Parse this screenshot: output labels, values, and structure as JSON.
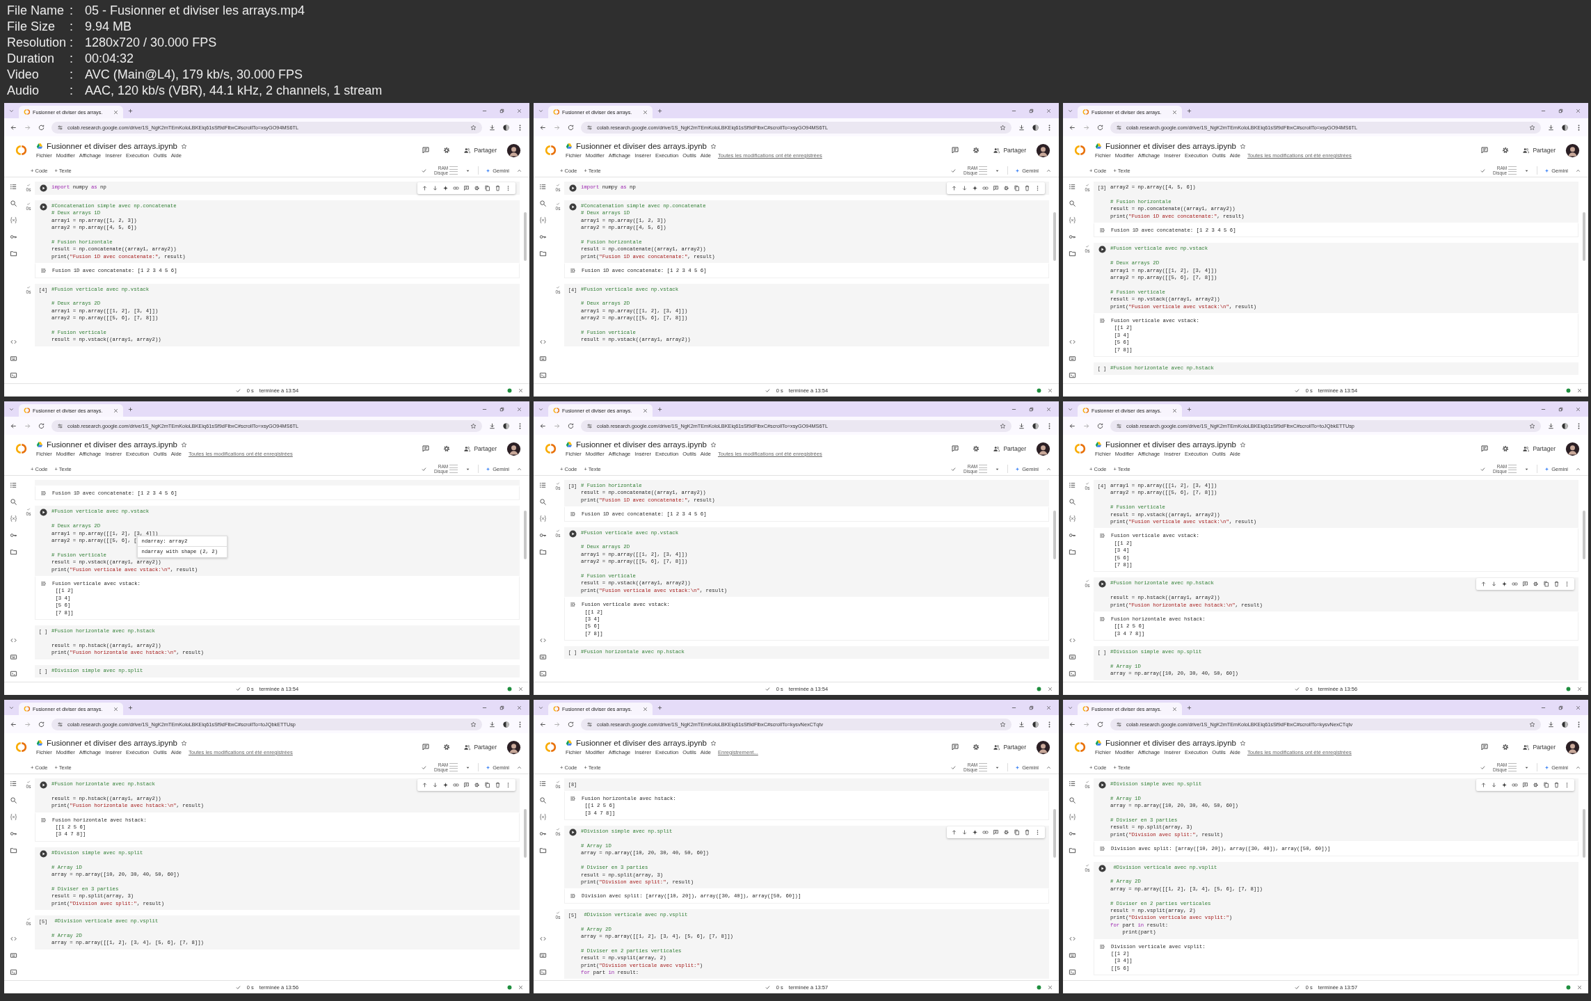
{
  "info": [
    {
      "label": "File Name",
      "separator": ":",
      "value": "05 - Fusionner et diviser les arrays.mp4"
    },
    {
      "label": "File Size",
      "separator": ":",
      "value": "9.94 MB"
    },
    {
      "label": "Resolution",
      "separator": ":",
      "value": "1280x720 / 30.000 FPS"
    },
    {
      "label": "Duration",
      "separator": ":",
      "value": "00:04:32"
    },
    {
      "label": "Video",
      "separator": ":",
      "value": "AVC (Main@L4), 179 kb/s, 30.000 FPS"
    },
    {
      "label": "Audio",
      "separator": ":",
      "value": "AAC, 120 kb/s (VBR), 44.1 kHz, 2 channels, 1 stream"
    }
  ],
  "frames": [
    {
      "tab_title": "Fusionner et diviser des arrays.",
      "url": "colab.research.google.com/drive/1S_NgK2mTEmKoloLBKEiq61sSf9dFlbxC#scrollTo=xsyGO94MS6TL",
      "notebook_title": "Fusionner et diviser des arrays.ipynb",
      "menu": [
        "Fichier",
        "Modifier",
        "Affichage",
        "Insérer",
        "Exécution",
        "Outils",
        "Aide"
      ],
      "add_code": "+ Code",
      "add_text": "+ Texte",
      "ram": "RAM",
      "disk": "Disque",
      "gemini": "Gemini",
      "share": "Partager",
      "run_time": "0 s",
      "finished": "terminée à 13:54",
      "cells": [
        {
          "time": "0s",
          "kind": "run",
          "toolbar": true,
          "blocks": [
            [
              {
                "kind": "mixed",
                "parts": [
                  {
                    "kind": "keyword",
                    "text": "import"
                  },
                  {
                    "kind": "plain",
                    "text": " numpy "
                  },
                  {
                    "kind": "keyword",
                    "text": "as"
                  },
                  {
                    "kind": "plain",
                    "text": " np"
                  }
                ]
              }
            ]
          ]
        },
        {
          "time": "0s",
          "kind": "run",
          "toolbar": false,
          "blocks": [
            [
              {
                "kind": "comment",
                "text": "#Concatenation simple avec np.concatenate"
              },
              {
                "kind": "comment",
                "text": "# Deux arrays 1D"
              },
              {
                "kind": "code",
                "text": "array1 = np.array([1, 2, 3])"
              },
              {
                "kind": "code",
                "text": "array2 = np.array([4, 5, 6])"
              }
            ],
            [
              {
                "kind": "comment",
                "text": "# Fusion horizontale"
              },
              {
                "kind": "code",
                "text": "result = np.concatenate((array1, array2))"
              },
              {
                "kind": "mixed",
                "parts": [
                  {
                    "kind": "plain",
                    "text": "print("
                  },
                  {
                    "kind": "string",
                    "text": "\"Fusion 1D avec concatenate:\""
                  },
                  {
                    "kind": "plain",
                    "text": ", result)"
                  }
                ]
              }
            ]
          ],
          "output": [
            "Fusion 1D avec concatenate: [1 2 3 4 5 6]"
          ]
        },
        {
          "time": "0s",
          "kind": "count",
          "count": "[4]",
          "toolbar": false,
          "blocks": [
            [
              {
                "kind": "comment",
                "text": "#Fusion verticale avec np.vstack"
              }
            ],
            [
              {
                "kind": "comment",
                "text": "# Deux arrays 2D"
              },
              {
                "kind": "code",
                "text": "array1 = np.array([[1, 2], [3, 4]])"
              },
              {
                "kind": "code",
                "text": "array2 = np.array([[5, 6], [7, 8]])"
              }
            ],
            [
              {
                "kind": "comment",
                "text": "# Fusion verticale"
              },
              {
                "kind": "code",
                "text": "result = np.vstack((array1, array2))"
              }
            ]
          ]
        }
      ]
    },
    {
      "tab_title": "Fusionner et diviser des arrays.",
      "url": "colab.research.google.com/drive/1S_NgK2mTEmKoloLBKEiq61sSf9dFlbxC#scrollTo=xsyGO94MS6TL",
      "notebook_title": "Fusionner et diviser des arrays.ipynb",
      "menu": [
        "Fichier",
        "Modifier",
        "Affichage",
        "Insérer",
        "Exécution",
        "Outils",
        "Aide"
      ],
      "save_status": "Toutes les modifications ont été enregistrées",
      "add_code": "+ Code",
      "add_text": "+ Texte",
      "ram": "RAM",
      "disk": "Disque",
      "gemini": "Gemini",
      "share": "Partager",
      "run_time": "0 s",
      "finished": "terminée à 13:54",
      "cells": [
        {
          "time": "0s",
          "kind": "run",
          "toolbar": true,
          "blocks": [
            [
              {
                "kind": "mixed",
                "parts": [
                  {
                    "kind": "keyword",
                    "text": "import"
                  },
                  {
                    "kind": "plain",
                    "text": " numpy "
                  },
                  {
                    "kind": "keyword",
                    "text": "as"
                  },
                  {
                    "kind": "plain",
                    "text": " np"
                  }
                ]
              }
            ]
          ]
        },
        {
          "time": "0s",
          "kind": "run",
          "toolbar": false,
          "blocks": [
            [
              {
                "kind": "comment",
                "text": "#Concatenation simple avec np.concatenate"
              },
              {
                "kind": "comment",
                "text": "# Deux arrays 1D"
              },
              {
                "kind": "code",
                "text": "array1 = np.array([1, 2, 3])"
              },
              {
                "kind": "code",
                "text": "array2 = np.array([4, 5, 6])"
              }
            ],
            [
              {
                "kind": "comment",
                "text": "# Fusion horizontale"
              },
              {
                "kind": "code",
                "text": "result = np.concatenate((array1, array2))"
              },
              {
                "kind": "mixed",
                "parts": [
                  {
                    "kind": "plain",
                    "text": "print("
                  },
                  {
                    "kind": "string",
                    "text": "\"Fusion 1D avec concatenate:\""
                  },
                  {
                    "kind": "plain",
                    "text": ", result)"
                  }
                ]
              }
            ]
          ],
          "output": [
            "Fusion 1D avec concatenate: [1 2 3 4 5 6]"
          ]
        },
        {
          "time": "0s",
          "kind": "count",
          "count": "[4]",
          "toolbar": false,
          "blocks": [
            [
              {
                "kind": "comment",
                "text": "#Fusion verticale avec np.vstack"
              }
            ],
            [
              {
                "kind": "comment",
                "text": "# Deux arrays 2D"
              },
              {
                "kind": "code",
                "text": "array1 = np.array([[1, 2], [3, 4]])"
              },
              {
                "kind": "code",
                "text": "array2 = np.array([[5, 6], [7, 8]])"
              }
            ],
            [
              {
                "kind": "comment",
                "text": "# Fusion verticale"
              },
              {
                "kind": "code",
                "text": "result = np.vstack((array1, array2))"
              }
            ]
          ]
        }
      ]
    },
    {
      "tab_title": "Fusionner et diviser des arrays.",
      "url": "colab.research.google.com/drive/1S_NgK2mTEmKoloLBKEiq61sSf9dFlbxC#scrollTo=xsyGO94MS6TL",
      "notebook_title": "Fusionner et diviser des arrays.ipynb",
      "menu": [
        "Fichier",
        "Modifier",
        "Affichage",
        "Insérer",
        "Exécution",
        "Outils",
        "Aide"
      ],
      "save_status": "Toutes les modifications ont été enregistrées",
      "add_code": "+ Code",
      "add_text": "+ Texte",
      "ram": "RAM",
      "disk": "Disque",
      "gemini": "Gemini",
      "share": "Partager",
      "run_time": "0 s",
      "finished": "terminée à 13:54",
      "cells": [
        {
          "time": "0s",
          "kind": "count",
          "count": "[3]",
          "toolbar": false,
          "blocks": [
            [
              {
                "kind": "code",
                "text": "array2 = np.array([4, 5, 6])"
              }
            ],
            [
              {
                "kind": "comment",
                "text": "# Fusion horizontale"
              },
              {
                "kind": "code",
                "text": "result = np.concatenate((array1, array2))"
              },
              {
                "kind": "mixed",
                "parts": [
                  {
                    "kind": "plain",
                    "text": "print("
                  },
                  {
                    "kind": "string",
                    "text": "\"Fusion 1D avec concatenate:\""
                  },
                  {
                    "kind": "plain",
                    "text": ", result)"
                  }
                ]
              }
            ]
          ],
          "output": [
            "Fusion 1D avec concatenate: [1 2 3 4 5 6]"
          ]
        },
        {
          "time": "0s",
          "kind": "run",
          "toolbar": false,
          "blocks": [
            [
              {
                "kind": "comment",
                "text": "#Fusion verticale avec np.vstack"
              }
            ],
            [
              {
                "kind": "comment",
                "text": "# Deux arrays 2D"
              },
              {
                "kind": "code",
                "text": "array1 = np.array([[1, 2], [3, 4]])"
              },
              {
                "kind": "code",
                "text": "array2 = np.array([[5, 6], [7, 8]])"
              }
            ],
            [
              {
                "kind": "comment",
                "text": "# Fusion verticale"
              },
              {
                "kind": "code",
                "text": "result = np.vstack((array1, array2))"
              },
              {
                "kind": "mixed",
                "parts": [
                  {
                    "kind": "plain",
                    "text": "print("
                  },
                  {
                    "kind": "string",
                    "text": "\"Fusion verticale avec vstack:\\n\""
                  },
                  {
                    "kind": "plain",
                    "text": ", result)"
                  }
                ]
              }
            ]
          ],
          "output": [
            "Fusion verticale avec vstack:",
            " [[1 2]",
            " [3 4]",
            " [5 6]",
            " [7 8]]"
          ]
        },
        {
          "kind": "count",
          "count": "[ ]",
          "toolbar": false,
          "blocks": [
            [
              {
                "kind": "comment",
                "text": "#Fusion horizontale avec np.hstack"
              }
            ]
          ]
        }
      ]
    },
    {
      "tab_title": "Fusionner et diviser des arrays.",
      "url": "colab.research.google.com/drive/1S_NgK2mTEmKoloLBKEiq61sSf9dFlbxC#scrollTo=xsyGO94MS6TL",
      "notebook_title": "Fusionner et diviser des arrays.ipynb",
      "menu": [
        "Fichier",
        "Modifier",
        "Affichage",
        "Insérer",
        "Exécution",
        "Outils",
        "Aide"
      ],
      "save_status": "Toutes les modifications ont été enregistrées",
      "add_code": "+ Code",
      "add_text": "+ Texte",
      "ram": "RAM",
      "disk": "Disque",
      "gemini": "Gemini",
      "share": "Partager",
      "run_time": "0 s",
      "finished": "terminée à 13:54",
      "cells": [
        {
          "kind": "output",
          "toolbar": false,
          "output": [
            "Fusion 1D avec concatenate: [1 2 3 4 5 6]"
          ]
        },
        {
          "time": "0s",
          "kind": "run",
          "toolbar": false,
          "blocks": [
            [
              {
                "kind": "comment",
                "text": "#Fusion verticale avec np.vstack"
              }
            ],
            [
              {
                "kind": "comment",
                "text": "# Deux arrays 2D"
              },
              {
                "kind": "code",
                "text": "array1 = np.array([[1, 2], [3, 4]])"
              },
              {
                "kind": "code",
                "text": "array2 = np.array([[5, 6], [",
                "tooltip": [
                  "ndarray: array2",
                  "ndarray with shape (2, 2)"
                ]
              }
            ],
            [
              {
                "kind": "comment",
                "text": "# Fusion verticale"
              },
              {
                "kind": "code",
                "text": "result = np.vstack((array1, array2))"
              },
              {
                "kind": "mixed",
                "parts": [
                  {
                    "kind": "plain",
                    "text": "print("
                  },
                  {
                    "kind": "string",
                    "text": "\"Fusion verticale avec vstack:\\n\""
                  },
                  {
                    "kind": "plain",
                    "text": ", result)"
                  }
                ]
              }
            ]
          ],
          "output": [
            "Fusion verticale avec vstack:",
            " [[1 2]",
            " [3 4]",
            " [5 6]",
            " [7 8]]"
          ]
        },
        {
          "kind": "count",
          "count": "[ ]",
          "toolbar": false,
          "blocks": [
            [
              {
                "kind": "comment",
                "text": "#Fusion horizontale avec np.hstack"
              }
            ],
            [
              {
                "kind": "code",
                "text": "result = np.hstack((array1, array2))"
              },
              {
                "kind": "mixed",
                "parts": [
                  {
                    "kind": "plain",
                    "text": "print("
                  },
                  {
                    "kind": "string",
                    "text": "\"Fusion horizontale avec hstack:\\n\""
                  },
                  {
                    "kind": "plain",
                    "text": ", result)"
                  }
                ]
              }
            ]
          ]
        },
        {
          "kind": "count",
          "count": "[ ]",
          "toolbar": false,
          "blocks": [
            [
              {
                "kind": "comment",
                "text": "#Division simple avec np.split"
              }
            ]
          ]
        }
      ]
    },
    {
      "tab_title": "Fusionner et diviser des arrays.",
      "url": "colab.research.google.com/drive/1S_NgK2mTEmKoloLBKEiq61sSf9dFlbxC#scrollTo=xsyGO94MS6TL",
      "notebook_title": "Fusionner et diviser des arrays.ipynb",
      "menu": [
        "Fichier",
        "Modifier",
        "Affichage",
        "Insérer",
        "Exécution",
        "Outils",
        "Aide"
      ],
      "save_status": "Toutes les modifications ont été enregistrées",
      "add_code": "+ Code",
      "add_text": "+ Texte",
      "ram": "RAM",
      "disk": "Disque",
      "gemini": "Gemini",
      "share": "Partager",
      "run_time": "0 s",
      "finished": "terminée à 13:54",
      "cells": [
        {
          "time": "0s",
          "kind": "count",
          "count": "[3]",
          "toolbar": false,
          "blocks": [
            [
              {
                "kind": "comment",
                "text": "# Fusion horizontale"
              },
              {
                "kind": "code",
                "text": "result = np.concatenate((array1, array2))"
              },
              {
                "kind": "mixed",
                "parts": [
                  {
                    "kind": "plain",
                    "text": "print("
                  },
                  {
                    "kind": "string",
                    "text": "\"Fusion 1D avec concatenate:\""
                  },
                  {
                    "kind": "plain",
                    "text": ", result)"
                  }
                ]
              }
            ]
          ],
          "output": [
            "Fusion 1D avec concatenate: [1 2 3 4 5 6]"
          ]
        },
        {
          "time": "0s",
          "kind": "run",
          "toolbar": false,
          "blocks": [
            [
              {
                "kind": "comment",
                "text": "#Fusion verticale avec np.vstack"
              }
            ],
            [
              {
                "kind": "comment",
                "text": "# Deux arrays 2D"
              },
              {
                "kind": "code",
                "text": "array1 = np.array([[1, 2], [3, 4]])"
              },
              {
                "kind": "code",
                "text": "array2 = np.array([[5, 6], [7, 8]])"
              }
            ],
            [
              {
                "kind": "comment",
                "text": "# Fusion verticale"
              },
              {
                "kind": "code",
                "text": "result = np.vstack((array1, array2))"
              },
              {
                "kind": "mixed",
                "parts": [
                  {
                    "kind": "plain",
                    "text": "print("
                  },
                  {
                    "kind": "string",
                    "text": "\"Fusion verticale avec vstack:\\n\""
                  },
                  {
                    "kind": "plain",
                    "text": ", result)"
                  }
                ]
              }
            ]
          ],
          "output": [
            "Fusion verticale avec vstack:",
            " [[1 2]",
            " [3 4]",
            " [5 6]",
            " [7 8]]"
          ]
        },
        {
          "kind": "count",
          "count": "[ ]",
          "toolbar": false,
          "blocks": [
            [
              {
                "kind": "comment",
                "text": "#Fusion horizontale avec np.hstack"
              }
            ]
          ]
        }
      ]
    },
    {
      "tab_title": "Fusionner et diviser des arrays.",
      "url": "colab.research.google.com/drive/1S_NgK2mTEmKoloLBKEiq61sSf9dFlbxC#scrollTo=toJQbkETTUsp",
      "notebook_title": "Fusionner et diviser des arrays.ipynb",
      "menu": [
        "Fichier",
        "Modifier",
        "Affichage",
        "Insérer",
        "Exécution",
        "Outils",
        "Aide"
      ],
      "add_code": "+ Code",
      "add_text": "+ Texte",
      "ram": "RAM",
      "disk": "Disque",
      "gemini": "Gemini",
      "share": "Partager",
      "run_time": "0 s",
      "finished": "terminée à 13:56",
      "cells": [
        {
          "time": "0s",
          "kind": "count",
          "count": "[4]",
          "toolbar": false,
          "blocks": [
            [
              {
                "kind": "code",
                "text": "array1 = np.array([[1, 2], [3, 4]])"
              },
              {
                "kind": "code",
                "text": "array2 = np.array([[5, 6], [7, 8]])"
              }
            ],
            [
              {
                "kind": "comment",
                "text": "# Fusion verticale"
              },
              {
                "kind": "code",
                "text": "result = np.vstack((array1, array2))"
              },
              {
                "kind": "mixed",
                "parts": [
                  {
                    "kind": "plain",
                    "text": "print("
                  },
                  {
                    "kind": "string",
                    "text": "\"Fusion verticale avec vstack:\\n\""
                  },
                  {
                    "kind": "plain",
                    "text": ", result)"
                  }
                ]
              }
            ]
          ],
          "output": [
            "Fusion verticale avec vstack:",
            " [[1 2]",
            " [3 4]",
            " [5 6]",
            " [7 8]]"
          ]
        },
        {
          "time": "0s",
          "kind": "run",
          "toolbar": true,
          "blocks": [
            [
              {
                "kind": "comment",
                "text": "#Fusion horizontale avec np.hstack"
              }
            ],
            [
              {
                "kind": "code",
                "text": "result = np.hstack((array1, array2))"
              },
              {
                "kind": "mixed",
                "parts": [
                  {
                    "kind": "plain",
                    "text": "print("
                  },
                  {
                    "kind": "string",
                    "text": "\"Fusion horizontale avec hstack:\\n\""
                  },
                  {
                    "kind": "plain",
                    "text": ", result)"
                  }
                ]
              }
            ]
          ],
          "output": [
            "Fusion horizontale avec hstack:",
            " [[1 2 5 6]",
            " [3 4 7 8]]"
          ]
        },
        {
          "kind": "count",
          "count": "[ ]",
          "toolbar": false,
          "blocks": [
            [
              {
                "kind": "comment",
                "text": "#Division simple avec np.split"
              }
            ],
            [
              {
                "kind": "comment",
                "text": "# Array 1D"
              },
              {
                "kind": "code",
                "text": "array = np.array([10, 20, 30, 40, 50, 60])"
              }
            ]
          ]
        }
      ]
    },
    {
      "tab_title": "Fusionner et diviser des arrays.",
      "url": "colab.research.google.com/drive/1S_NgK2mTEmKoloLBKEiq61sSf9dFlbxC#scrollTo=toJQbkETTUsp",
      "notebook_title": "Fusionner et diviser des arrays.ipynb",
      "menu": [
        "Fichier",
        "Modifier",
        "Affichage",
        "Insérer",
        "Exécution",
        "Outils",
        "Aide"
      ],
      "save_status": "Toutes les modifications ont été enregistrées",
      "add_code": "+ Code",
      "add_text": "+ Texte",
      "ram": "RAM",
      "disk": "Disque",
      "gemini": "Gemini",
      "share": "Partager",
      "run_time": "0 s",
      "finished": "terminée à 13:56",
      "cells": [
        {
          "time": "0s",
          "kind": "run",
          "toolbar": true,
          "blocks": [
            [
              {
                "kind": "comment",
                "text": "#Fusion horizontale avec np.hstack"
              }
            ],
            [
              {
                "kind": "code",
                "text": "result = np.hstack((array1, array2))"
              },
              {
                "kind": "mixed",
                "parts": [
                  {
                    "kind": "plain",
                    "text": "print("
                  },
                  {
                    "kind": "string",
                    "text": "\"Fusion horizontale avec hstack:\\n\""
                  },
                  {
                    "kind": "plain",
                    "text": ", result)"
                  }
                ]
              }
            ]
          ],
          "output": [
            "Fusion horizontale avec hstack:",
            " [[1 2 5 6]",
            " [3 4 7 8]]"
          ]
        },
        {
          "kind": "run",
          "toolbar": false,
          "blocks": [
            [
              {
                "kind": "comment",
                "text": "#Division simple avec np.split"
              }
            ],
            [
              {
                "kind": "comment",
                "text": "# Array 1D"
              },
              {
                "kind": "code",
                "text": "array = np.array([10, 20, 30, 40, 50, 60])"
              }
            ],
            [
              {
                "kind": "comment",
                "text": "# Diviser en 3 parties"
              },
              {
                "kind": "code",
                "text": "result = np.split(array, 3)"
              },
              {
                "kind": "mixed",
                "parts": [
                  {
                    "kind": "plain",
                    "text": "print("
                  },
                  {
                    "kind": "string",
                    "text": "\"Division avec split:\""
                  },
                  {
                    "kind": "plain",
                    "text": ", result)"
                  }
                ]
              }
            ]
          ]
        },
        {
          "time": "0s",
          "kind": "count",
          "count": "[5]",
          "toolbar": false,
          "blocks": [
            [
              {
                "kind": "comment",
                "text": " #Division verticale avec np.vsplit"
              }
            ],
            [
              {
                "kind": "comment",
                "text": "# Array 2D"
              },
              {
                "kind": "code",
                "text": "array = np.array([[1, 2], [3, 4], [5, 6], [7, 8]])"
              }
            ]
          ]
        }
      ]
    },
    {
      "tab_title": "Fusionner et diviser des arrays.",
      "url": "colab.research.google.com/drive/1S_NgK2mTEmKoloLBKEiq61sSf9dFlbxC#scrollTo=kysvNexCTqtv",
      "notebook_title": "Fusionner et diviser des arrays.ipynb",
      "menu": [
        "Fichier",
        "Modifier",
        "Affichage",
        "Insérer",
        "Exécution",
        "Outils",
        "Aide"
      ],
      "save_status": "Enregistrement...",
      "add_code": "+ Code",
      "add_text": "+ Texte",
      "ram": "RAM",
      "disk": "Disque",
      "gemini": "Gemini",
      "share": "Partager",
      "run_time": "0 s",
      "finished": "terminée à 13:57",
      "cells": [
        {
          "time": "0s",
          "kind": "count",
          "count": "[8]",
          "toolbar": false,
          "output": [
            "Fusion horizontale avec hstack:",
            " [[1 2 5 6]",
            " [3 4 7 8]]"
          ]
        },
        {
          "time": "0s",
          "kind": "run",
          "toolbar": true,
          "blocks": [
            [
              {
                "kind": "comment",
                "text": "#Division simple avec np.split"
              }
            ],
            [
              {
                "kind": "comment",
                "text": "# Array 1D"
              },
              {
                "kind": "code",
                "text": "array = np.array([10, 20, 30, 40, 50, 60])"
              }
            ],
            [
              {
                "kind": "comment",
                "text": "# Diviser en 3 parties"
              },
              {
                "kind": "code",
                "text": "result = np.split(array, 3)"
              },
              {
                "kind": "mixed",
                "parts": [
                  {
                    "kind": "plain",
                    "text": "print("
                  },
                  {
                    "kind": "string",
                    "text": "\"Division avec split:\""
                  },
                  {
                    "kind": "plain",
                    "text": ", result)"
                  }
                ]
              }
            ]
          ],
          "output": [
            "Division avec split: [array([10, 20]), array([30, 40]), array([50, 60])]"
          ]
        },
        {
          "time": "0s",
          "kind": "count",
          "count": "[5]",
          "toolbar": false,
          "blocks": [
            [
              {
                "kind": "comment",
                "text": " #Division verticale avec np.vsplit"
              }
            ],
            [
              {
                "kind": "comment",
                "text": "# Array 2D"
              },
              {
                "kind": "code",
                "text": "array = np.array([[1, 2], [3, 4], [5, 6], [7, 8]])"
              }
            ],
            [
              {
                "kind": "comment",
                "text": "# Diviser en 2 parties verticales"
              },
              {
                "kind": "code",
                "text": "result = np.vsplit(array, 2)"
              },
              {
                "kind": "mixed",
                "parts": [
                  {
                    "kind": "plain",
                    "text": "print("
                  },
                  {
                    "kind": "string",
                    "text": "\"Division verticale avec vsplit:\""
                  },
                  {
                    "kind": "plain",
                    "text": ")"
                  }
                ]
              },
              {
                "kind": "mixed",
                "parts": [
                  {
                    "kind": "keyword",
                    "text": "for"
                  },
                  {
                    "kind": "plain",
                    "text": " part "
                  },
                  {
                    "kind": "keyword",
                    "text": "in"
                  },
                  {
                    "kind": "plain",
                    "text": " result:"
                  }
                ]
              }
            ]
          ]
        }
      ]
    },
    {
      "tab_title": "Fusionner et diviser des arrays.",
      "url": "colab.research.google.com/drive/1S_NgK2mTEmKoloLBKEiq61sSf9dFlbxC#scrollTo=kysvNexCTqtv",
      "notebook_title": "Fusionner et diviser des arrays.ipynb",
      "menu": [
        "Fichier",
        "Modifier",
        "Affichage",
        "Insérer",
        "Exécution",
        "Outils",
        "Aide"
      ],
      "save_status": "Toutes les modifications ont été enregistrées",
      "add_code": "+ Code",
      "add_text": "+ Texte",
      "ram": "RAM",
      "disk": "Disque",
      "gemini": "Gemini",
      "share": "Partager",
      "run_time": "0 s",
      "finished": "terminée à 13:57",
      "cells": [
        {
          "time": "0s",
          "kind": "run",
          "toolbar": true,
          "blocks": [
            [
              {
                "kind": "comment",
                "text": "#Division simple avec np.split"
              }
            ],
            [
              {
                "kind": "comment",
                "text": "# Array 1D"
              },
              {
                "kind": "code",
                "text": "array = np.array([10, 20, 30, 40, 50, 60])"
              }
            ],
            [
              {
                "kind": "comment",
                "text": "# Diviser en 3 parties"
              },
              {
                "kind": "code",
                "text": "result = np.split(array, 3)"
              },
              {
                "kind": "mixed",
                "parts": [
                  {
                    "kind": "plain",
                    "text": "print("
                  },
                  {
                    "kind": "string",
                    "text": "\"Division avec split:\""
                  },
                  {
                    "kind": "plain",
                    "text": ", result)"
                  }
                ]
              }
            ]
          ],
          "output": [
            "Division avec split: [array([10, 20]), array([30, 40]), array([50, 60])]"
          ]
        },
        {
          "time": "0s",
          "kind": "run",
          "toolbar": false,
          "blocks": [
            [
              {
                "kind": "comment",
                "text": " #Division verticale avec np.vsplit"
              }
            ],
            [
              {
                "kind": "comment",
                "text": "# Array 2D"
              },
              {
                "kind": "code",
                "text": "array = np.array([[1, 2], [3, 4], [5, 6], [7, 8]])"
              }
            ],
            [
              {
                "kind": "comment",
                "text": "# Diviser en 2 parties verticales"
              },
              {
                "kind": "code",
                "text": "result = np.vsplit(array, 2)"
              },
              {
                "kind": "mixed",
                "parts": [
                  {
                    "kind": "plain",
                    "text": "print("
                  },
                  {
                    "kind": "string",
                    "text": "\"Division verticale avec vsplit:\""
                  },
                  {
                    "kind": "plain",
                    "text": ")"
                  }
                ]
              },
              {
                "kind": "mixed",
                "parts": [
                  {
                    "kind": "keyword",
                    "text": "for"
                  },
                  {
                    "kind": "plain",
                    "text": " part "
                  },
                  {
                    "kind": "keyword",
                    "text": "in"
                  },
                  {
                    "kind": "plain",
                    "text": " result:"
                  }
                ]
              },
              {
                "kind": "code",
                "text": "    print(part)"
              }
            ]
          ],
          "output": [
            "Division verticale avec vsplit:",
            "[[1 2]",
            " [3 4]]",
            "[[5 6]"
          ]
        }
      ]
    }
  ]
}
